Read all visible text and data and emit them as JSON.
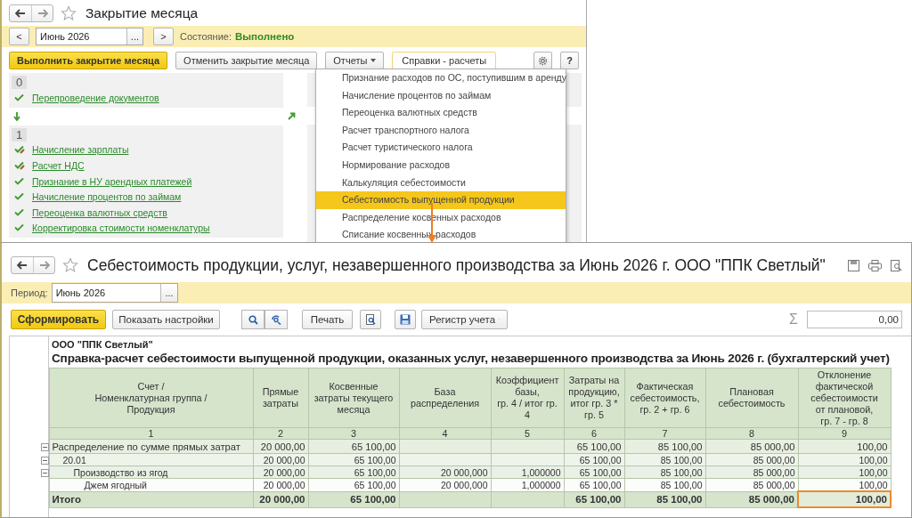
{
  "month_close": {
    "title": "Закрытие месяца",
    "prev_button": "<",
    "period": {
      "value": "Июнь 2026"
    },
    "pick_button": "...",
    "next_button": ">",
    "state_label": "Состояние:",
    "state_value": "Выполнено",
    "toolbar": {
      "run_button": "Выполнить закрытие месяца",
      "cancel_button": "Отменить закрытие месяца",
      "reports_button": "Отчеты",
      "calculations_button": "Справки - расчеты",
      "help_button": "?"
    },
    "steps": [
      {
        "number": "0",
        "items": [
          {
            "label": "Перепроведение документов",
            "done": true,
            "edited": false
          }
        ]
      },
      {
        "number": "1",
        "items": [
          {
            "label": "Начисление зарплаты",
            "done": true,
            "edited": true
          },
          {
            "label": "Расчет НДС",
            "done": true,
            "edited": true
          },
          {
            "label": "Признание в НУ арендных платежей",
            "done": true,
            "edited": false
          },
          {
            "label": "Начисление процентов по займам",
            "done": true,
            "edited": false
          },
          {
            "label": "Переоценка валютных средств",
            "done": true,
            "edited": false
          },
          {
            "label": "Корректировка стоимости номенклатуры",
            "done": true,
            "edited": false
          }
        ]
      }
    ]
  },
  "calculations_menu": {
    "items": [
      {
        "label": "Признание расходов по ОС, поступившим в аренду",
        "selected": false
      },
      {
        "label": "Начисление процентов по займам",
        "selected": false
      },
      {
        "label": "Переоценка валютных средств",
        "selected": false
      },
      {
        "label": "Расчет транспортного налога",
        "selected": false
      },
      {
        "label": "Расчет туристического налога",
        "selected": false
      },
      {
        "label": "Нормирование расходов",
        "selected": false
      },
      {
        "label": "Калькуляция себестоимости",
        "selected": false
      },
      {
        "label": "Себестоимость выпущенной продукции",
        "selected": true
      },
      {
        "label": "Распределение косвенных расходов",
        "selected": false
      },
      {
        "label": "Списание косвенных расходов",
        "selected": false
      }
    ]
  },
  "report": {
    "title": "Себестоимость продукции, услуг, незавершенного производства за Июнь 2026 г. ООО \"ППК Светлый\"",
    "period_label": "Период:",
    "period": {
      "value": "Июнь 2026"
    },
    "pick_button": "...",
    "toolbar": {
      "generate_button": "Сформировать",
      "settings_button": "Показать настройки",
      "print_button": "Печать",
      "register_button": "Регистр учета",
      "sum_symbol": "Σ",
      "sum_value": "0,00"
    },
    "organization": "ООО \"ППК Светлый\"",
    "heading": "Справка-расчет себестоимости выпущенной продукции, оказанных услуг, незавершенного производства за Июнь 2026 г. (бухгалтерский учет)",
    "table": {
      "columns": [
        {
          "header": "Счет /\nНоменклатурная группа /\nПродукция",
          "number": "1"
        },
        {
          "header": "Прямые\nзатраты",
          "number": "2"
        },
        {
          "header": "Косвенные\nзатраты текущего\nмесяца",
          "number": "3"
        },
        {
          "header": "База\nраспределения",
          "number": "4"
        },
        {
          "header": "Коэффициент\nбазы,\nгр. 4 / итог гр.\n4",
          "number": "5"
        },
        {
          "header": "Затраты на\nпродукцию,\nитог гр. 3 *\nгр. 5",
          "number": "6"
        },
        {
          "header": "Фактическая\nсебестоимость,\nгр. 2 + гр. 6",
          "number": "7"
        },
        {
          "header": "Плановая\nсебестоимость",
          "number": "8"
        },
        {
          "header": "Отклонение\nфактической\nсебестоимости\nот плановой,\nгр. 7 - гр. 8",
          "number": "9"
        }
      ],
      "rows": [
        {
          "name": "Распределение по сумме прямых затрат",
          "values": {
            "c2": "20 000,00",
            "c3": "65 100,00",
            "c6": "65 100,00",
            "c7": "85 100,00",
            "c8": "85 000,00",
            "c9": "100,00"
          },
          "expanded": true,
          "children": [
            {
              "name": "20.01",
              "values": {
                "c2": "20 000,00",
                "c3": "65 100,00",
                "c6": "65 100,00",
                "c7": "85 100,00",
                "c8": "85 000,00",
                "c9": "100,00"
              },
              "expanded": true,
              "children": [
                {
                  "name": "Производство из ягод",
                  "values": {
                    "c2": "20 000,00",
                    "c3": "65 100,00",
                    "c4": "20 000,000",
                    "c5": "1,000000",
                    "c6": "65 100,00",
                    "c7": "85 100,00",
                    "c8": "85 000,00",
                    "c9": "100,00"
                  },
                  "expanded": true,
                  "children": [
                    {
                      "name": "Джем ягодный",
                      "values": {
                        "c2": "20 000,00",
                        "c3": "65 100,00",
                        "c4": "20 000,000",
                        "c5": "1,000000",
                        "c6": "65 100,00",
                        "c7": "85 100,00",
                        "c8": "85 000,00",
                        "c9": "100,00"
                      }
                    }
                  ]
                }
              ]
            }
          ]
        }
      ],
      "total": {
        "label": "Итого",
        "cells": [
          {
            "text": "20 000,00",
            "selected": false
          },
          {
            "text": "65 100,00",
            "selected": false
          },
          {
            "selected": false
          },
          {
            "selected": false
          },
          {
            "text": "65 100,00",
            "selected": false
          },
          {
            "text": "85 100,00",
            "selected": false
          },
          {
            "text": "85 000,00",
            "selected": false
          },
          {
            "text": "100,00",
            "selected": true
          }
        ]
      }
    }
  }
}
